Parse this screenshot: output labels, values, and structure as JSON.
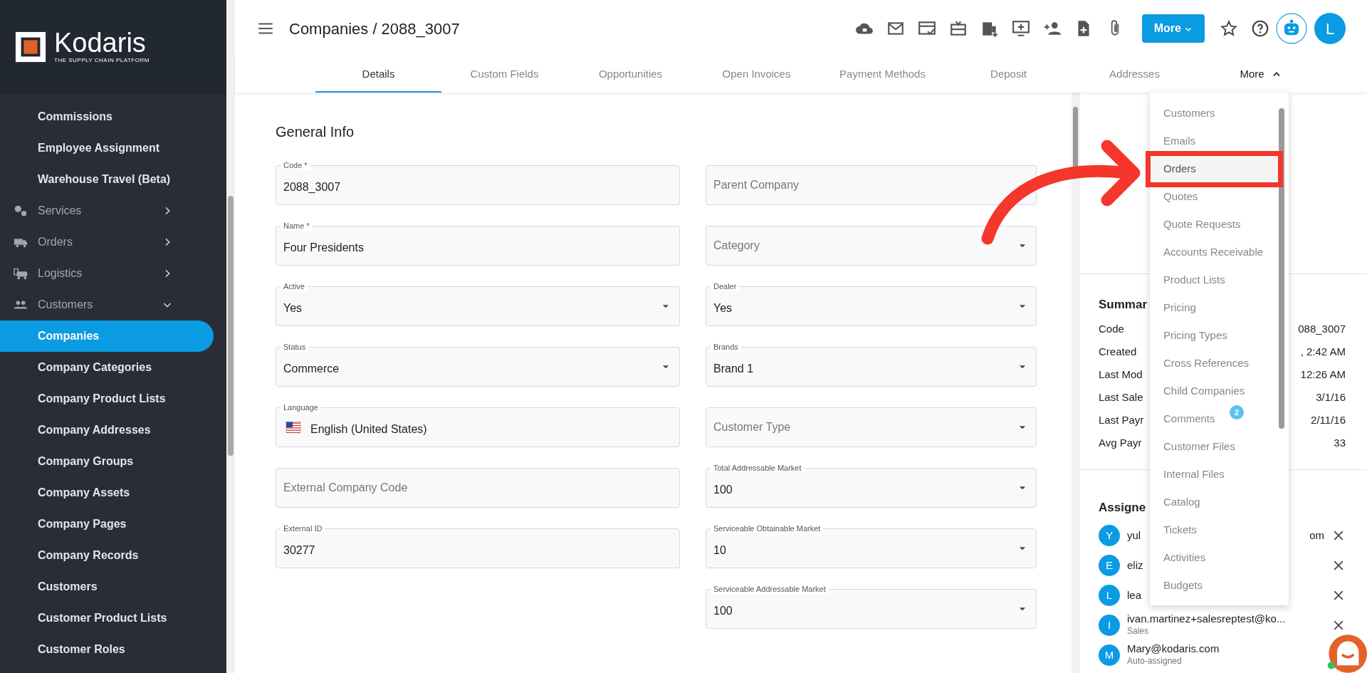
{
  "sidebar": {
    "logo": {
      "name": "Kodaris",
      "tagline": "THE SUPPLY CHAIN PLATFORM"
    },
    "items": [
      {
        "label": "Commissions",
        "kind": "sub",
        "selected": false
      },
      {
        "label": "Employee Assignment",
        "kind": "sub",
        "selected": false
      },
      {
        "label": "Warehouse Travel (Beta)",
        "kind": "sub",
        "selected": false
      },
      {
        "label": "Services",
        "kind": "group",
        "expanded": false
      },
      {
        "label": "Orders",
        "kind": "group",
        "expanded": false
      },
      {
        "label": "Logistics",
        "kind": "group",
        "expanded": false
      },
      {
        "label": "Customers",
        "kind": "group",
        "expanded": true
      },
      {
        "label": "Companies",
        "kind": "sub",
        "selected": true
      },
      {
        "label": "Company Categories",
        "kind": "sub",
        "selected": false
      },
      {
        "label": "Company Product Lists",
        "kind": "sub",
        "selected": false
      },
      {
        "label": "Company Addresses",
        "kind": "sub",
        "selected": false
      },
      {
        "label": "Company Groups",
        "kind": "sub",
        "selected": false
      },
      {
        "label": "Company Assets",
        "kind": "sub",
        "selected": false
      },
      {
        "label": "Company Pages",
        "kind": "sub",
        "selected": false
      },
      {
        "label": "Company Records",
        "kind": "sub",
        "selected": false
      },
      {
        "label": "Customers",
        "kind": "sub",
        "selected": false
      },
      {
        "label": "Customer Product Lists",
        "kind": "sub",
        "selected": false
      },
      {
        "label": "Customer Roles",
        "kind": "sub",
        "selected": false
      }
    ]
  },
  "header": {
    "title": "Companies / 2088_3007",
    "more_button": "More",
    "avatar": "L"
  },
  "tabs": [
    {
      "label": "Details",
      "selected": true
    },
    {
      "label": "Custom Fields",
      "selected": false
    },
    {
      "label": "Opportunities",
      "selected": false
    },
    {
      "label": "Open Invoices",
      "selected": false
    },
    {
      "label": "Payment Methods",
      "selected": false
    },
    {
      "label": "Deposit",
      "selected": false
    },
    {
      "label": "Addresses",
      "selected": false
    },
    {
      "label": "More",
      "selected": false,
      "expanded": true
    }
  ],
  "form": {
    "title": "General Info",
    "left": [
      {
        "kind": "text",
        "label": "Code *",
        "value": "2088_3007"
      },
      {
        "kind": "text",
        "label": "Name *",
        "value": "Four Presidents"
      },
      {
        "kind": "select",
        "label": "Active",
        "value": "Yes"
      },
      {
        "kind": "select",
        "label": "Status",
        "value": "Commerce"
      },
      {
        "kind": "language",
        "label": "Language",
        "value": "English (United States)"
      },
      {
        "kind": "text",
        "placeholder": "External Company Code"
      },
      {
        "kind": "text",
        "label": "External ID",
        "value": "30277"
      }
    ],
    "right": [
      {
        "kind": "text",
        "placeholder": "Parent Company"
      },
      {
        "kind": "select",
        "placeholder": "Category"
      },
      {
        "kind": "select",
        "label": "Dealer",
        "value": "Yes"
      },
      {
        "kind": "select",
        "label": "Brands",
        "value": "Brand 1"
      },
      {
        "kind": "select",
        "placeholder": "Customer Type"
      },
      {
        "kind": "select",
        "label": "Total Addressable Market",
        "value": "100"
      },
      {
        "kind": "select",
        "label": "Serviceable Obtainable Market",
        "value": "10"
      },
      {
        "kind": "select",
        "label": "Serviceable Addressable Market",
        "value": "100"
      }
    ]
  },
  "summary": {
    "title": "Summar",
    "rows": [
      {
        "label": "Code",
        "value": "088_3007"
      },
      {
        "label": "Created",
        "value": ", 2:42 AM"
      },
      {
        "label": "Last Mod",
        "value": "12:26 AM"
      },
      {
        "label": "Last Sale",
        "value": "3/1/16"
      },
      {
        "label": "Last Payr",
        "value": "2/11/16"
      },
      {
        "label": "Avg Payr",
        "value": "33"
      }
    ]
  },
  "assigned": {
    "title": "Assigne",
    "people": [
      {
        "initial": "Y",
        "email": "yul",
        "email_end": "om"
      },
      {
        "initial": "E",
        "email": "eliz"
      },
      {
        "initial": "L",
        "email": "lea"
      },
      {
        "initial": "I",
        "email": "ivan.martinez+salesreptest@ko...",
        "role": "Sales"
      },
      {
        "initial": "M",
        "email": "Mary@kodaris.com",
        "role": "Auto-assigned"
      }
    ]
  },
  "more_menu": {
    "items": [
      {
        "label": "Customers",
        "selected": false
      },
      {
        "label": "Emails",
        "selected": false
      },
      {
        "label": "Orders",
        "selected": true,
        "highlighted": true
      },
      {
        "label": "Quotes",
        "selected": false
      },
      {
        "label": "Quote Requests",
        "selected": false
      },
      {
        "label": "Accounts Receivable",
        "selected": false
      },
      {
        "label": "Product Lists",
        "selected": false
      },
      {
        "label": "Pricing",
        "selected": false
      },
      {
        "label": "Pricing Types",
        "selected": false
      },
      {
        "label": "Cross References",
        "selected": false
      },
      {
        "label": "Child Companies",
        "selected": false
      },
      {
        "label": "Comments",
        "selected": false,
        "badge": "2"
      },
      {
        "label": "Customer Files",
        "selected": false
      },
      {
        "label": "Internal Files",
        "selected": false
      },
      {
        "label": "Catalog",
        "selected": false
      },
      {
        "label": "Tickets",
        "selected": false
      },
      {
        "label": "Activities",
        "selected": false
      },
      {
        "label": "Budgets",
        "selected": false
      }
    ]
  }
}
